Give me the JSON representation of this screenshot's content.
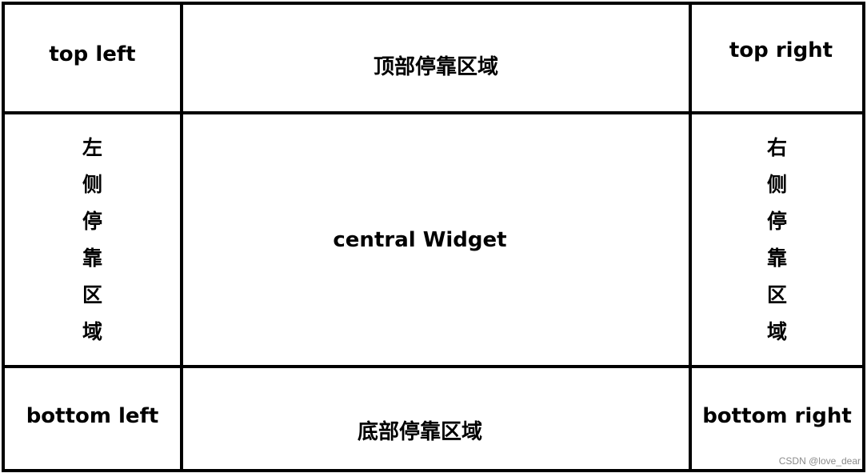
{
  "regions": {
    "top_left": "top left",
    "top_dock": "顶部停靠区域",
    "top_right": "top right",
    "left_dock": [
      "左",
      "侧",
      "停",
      "靠",
      "区",
      "域"
    ],
    "central": "central Widget",
    "right_dock": [
      "右",
      "侧",
      "停",
      "靠",
      "区",
      "域"
    ],
    "bottom_left": "bottom left",
    "bottom_dock": "底部停靠区域",
    "bottom_right": "bottom right"
  },
  "watermark": "CSDN @love_dear"
}
